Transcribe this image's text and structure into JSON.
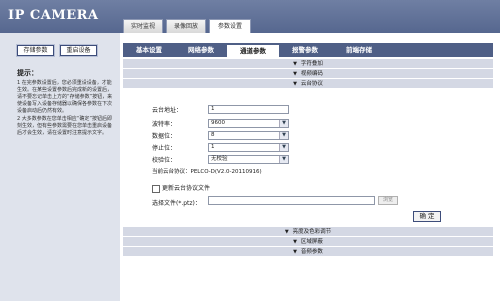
{
  "app": {
    "title": "IP CAMERA"
  },
  "top_tabs": [
    "实时监视",
    "录像回放",
    "参数设置"
  ],
  "left": {
    "save_label": "存储参数",
    "restart_label": "重启设备",
    "tips_title": "提示：",
    "tips": [
      "1  在完参数设置后，您必须重设设备，才能生效。在某些设置参数后完成新的设置后，请不要忘记单击上方的“存储参数”按钮，来使设备写入设备存储器以确保各参数在下次设备启动后仍然有效。",
      "2  大多数参数在您单击相应“确定”按钮后即刻生效，但有些参数需要在您单击重启设备后才会生效，请在设置时注意提示文字。"
    ]
  },
  "sub_tabs": [
    "基本设置",
    "网络参数",
    "通道参数",
    "报警参数",
    "前端存储"
  ],
  "sections": {
    "osd": "字符叠加",
    "video": "视频编码",
    "ptz": "云台协议",
    "image": "亮度及色彩调节",
    "mask": "区域屏蔽",
    "audio": "音频参数"
  },
  "form": {
    "address_label": "云台地址：",
    "address_value": "1",
    "baud_label": "波特率：",
    "baud_value": "9600",
    "databits_label": "数据位：",
    "databits_value": "8",
    "stopbits_label": "停止位：",
    "stopbits_value": "1",
    "parity_label": "校验位：",
    "parity_value": "无校验",
    "version_text": "当前云台协议：PELCO-D(V2.0-20110916)",
    "update_label": "更新云台协议文件",
    "file_label": "选择文件(*.ptz)：",
    "browse_label": "浏览",
    "confirm_label": "确 定"
  }
}
